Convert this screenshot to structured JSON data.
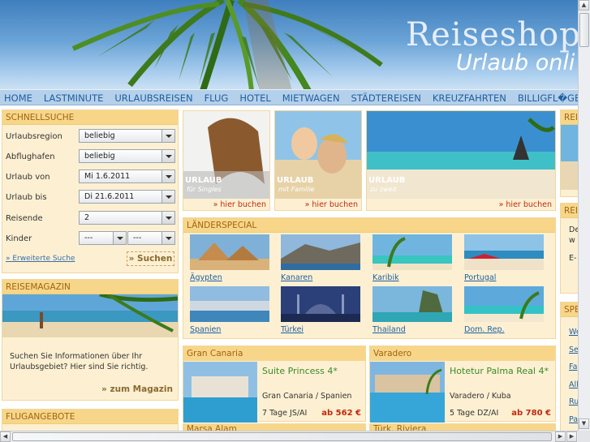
{
  "header": {
    "logo_line1": "Reiseshop",
    "logo_line2": "Urlaub onli"
  },
  "nav": [
    "HOME",
    "LASTMINUTE",
    "URLAUBSREISEN",
    "FLUG",
    "HOTEL",
    "MIETWAGEN",
    "STÄDTEREISEN",
    "KREUZFAHRTEN",
    "BILLIGFL�GE"
  ],
  "search": {
    "title": "SCHNELLSUCHE",
    "region_label": "Urlaubsregion",
    "region_value": "beliebig",
    "airport_label": "Abflughafen",
    "airport_value": "beliebig",
    "from_label": "Urlaub von",
    "from_value": "Mi 1.6.2011",
    "to_label": "Urlaub bis",
    "to_value": "Di 21.6.2011",
    "travellers_label": "Reisende",
    "travellers_value": "2",
    "children_label": "Kinder",
    "child1_value": "---",
    "child2_value": "---",
    "advanced_link": "» Erweiterte Suche",
    "button": "» Suchen"
  },
  "magazine": {
    "title": "REISEMAGAZIN",
    "text": "Suchen Sie Informationen über Ihr Urlaubsgebiet? Hier sind Sie richtig.",
    "link": "» zum Magazin"
  },
  "flights": {
    "title": "FLUGANGEBOTE",
    "row": "",
    "price": ""
  },
  "promos": [
    {
      "title": "URLAUB",
      "sub": "für Singles",
      "book": "hier buchen"
    },
    {
      "title": "URLAUB",
      "sub": "mit Familie",
      "book": "hier buchen"
    },
    {
      "title": "URLAUB",
      "sub": "zu zweit",
      "book": "hier buchen"
    }
  ],
  "countries": {
    "title": "LÄNDERSPECIAL",
    "items": [
      "Ägypten",
      "Kanaren",
      "Karibik",
      "Portugal",
      "Spanien",
      "Türkei",
      "Thailand",
      "Dom. Rep."
    ]
  },
  "hotels": [
    {
      "region": "Gran Canaria",
      "name": "Suite Princess 4*",
      "location": "Gran Canaria / Spanien",
      "duration": "7 Tage JS/AI",
      "price": "ab 562 €"
    },
    {
      "region": "Varadero",
      "name": "Hotetur Palma Real 4*",
      "location": "Varadero / Kuba",
      "duration": "5 Tage DZ/AI",
      "price": "ab 780 €"
    },
    {
      "region": "Marsa Alam"
    },
    {
      "region": "Türk. Riviera"
    }
  ],
  "right": {
    "box1": "REISE",
    "box2": "REIS",
    "box2_text": "De w",
    "box2_email": "E-",
    "box3": "SPE",
    "links": [
      "We",
      "Se",
      "Fa",
      "All",
      "Ru",
      "Pa"
    ]
  }
}
